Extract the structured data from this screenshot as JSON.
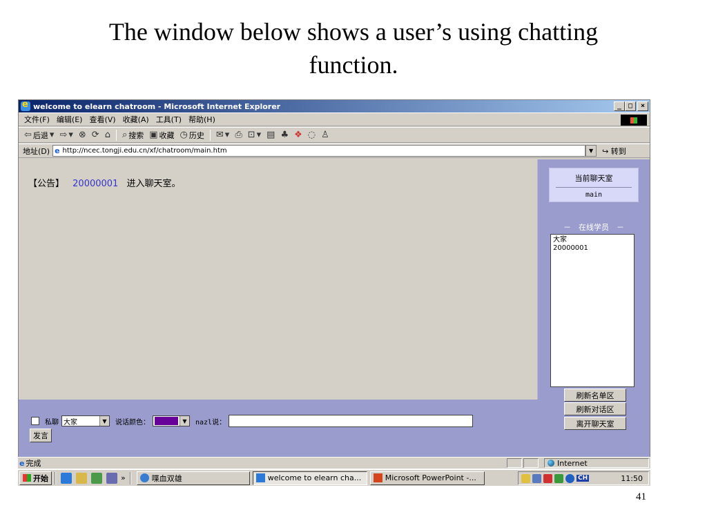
{
  "slide": {
    "title_line1": "The window below shows a user’s using chatting",
    "title_line2": "function.",
    "page_number": "41"
  },
  "window": {
    "title": "welcome to elearn chatroom - Microsoft Internet Explorer",
    "controls": {
      "minimize": "_",
      "maximize": "□",
      "close": "×"
    }
  },
  "menu": {
    "file": "文件(F)",
    "edit": "编辑(E)",
    "view": "查看(V)",
    "favorites": "收藏(A)",
    "tools": "工具(T)",
    "help": "帮助(H)"
  },
  "toolbar": {
    "back": "后退",
    "search": "搜索",
    "favorites": "收藏",
    "history": "历史"
  },
  "address": {
    "label": "地址(D)",
    "url": "http://ncec.tongji.edu.cn/xf/chatroom/main.htm",
    "go": "转到"
  },
  "chat": {
    "announce_tag": "【公告】",
    "announce_user": "20000001",
    "announce_text": "进入聊天室。"
  },
  "sidebar": {
    "current_room_label": "当前聊天室",
    "current_room": "main",
    "online_title": "－　在线学员　－",
    "online_users": [
      "大家",
      "20000001"
    ],
    "refresh_list": "刷新名单区",
    "refresh_chat": "刷新对话区",
    "leave_room": "离开聊天室"
  },
  "input": {
    "private_label": "私聊",
    "recipient": "大家",
    "color_label": "说话颜色：",
    "speaker_label": "nazl说：",
    "speak_value": "",
    "send": "发言",
    "selected_color": "#660099"
  },
  "status": {
    "text": "完成",
    "zone": "Internet"
  },
  "taskbar": {
    "start": "开始",
    "more": "»",
    "tasks": [
      {
        "label": "喋血双雄",
        "icon": "search-app-icon"
      },
      {
        "label": "welcome to elearn cha...",
        "icon": "ie-page-icon"
      },
      {
        "label": "Microsoft PowerPoint -...",
        "icon": "powerpoint-icon"
      }
    ],
    "ime": "CH",
    "clock": "11:50"
  }
}
